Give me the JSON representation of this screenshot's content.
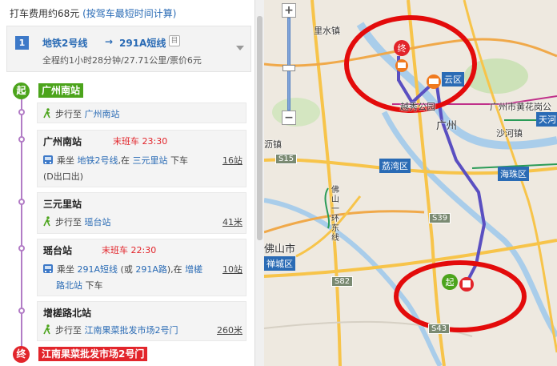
{
  "taxi": {
    "text": "打车费用约68元",
    "link": "(按驾车最短时间计算)"
  },
  "route": {
    "number": "1",
    "line_a": "地铁2号线",
    "arrow": "→",
    "line_b": "291A短线",
    "print_glyph": "目",
    "summary": "全程约1小时28分钟/27.71公里/票价6元"
  },
  "start": {
    "badge": "起",
    "label": "广州南站"
  },
  "end": {
    "badge": "终",
    "label": "江南果菜批发市场2号门"
  },
  "steps": [
    {
      "type": "walk",
      "prefix": "步行至",
      "target": "广州南站"
    },
    {
      "type": "transit",
      "title": "广州南站",
      "last_bus": "末班车 23:30",
      "ride_prefix": "乘坐",
      "line": "地铁2号线",
      "ride_mid": ",在",
      "stop": "三元里站",
      "ride_suffix": "下车",
      "note": "(D出口出)",
      "distance": "16站"
    },
    {
      "type": "walk",
      "title": "三元里站",
      "prefix": "步行至",
      "target": "瑶台站",
      "distance": "41米"
    },
    {
      "type": "transit",
      "title": "瑶台站",
      "last_bus": "末班车 22:30",
      "ride_prefix": "乘坐",
      "line": "291A短线",
      "alt_open": "(或",
      "alt_line": "291A路",
      "alt_close": "),在",
      "stop": "增槎",
      "stop2": "路北站",
      "ride_suffix": "下车",
      "distance": "10站"
    },
    {
      "type": "walk",
      "title": "增槎路北站",
      "prefix": "步行至",
      "target": "江南果菜批发市场2号门",
      "distance": "260米"
    }
  ],
  "map": {
    "zoom_in": "+",
    "zoom_out": "−",
    "labels": {
      "lihe": "里水镇",
      "baiyun": "云区",
      "gz_city": "广州",
      "huangpu": "广州市黄花岗公",
      "shahe": "沙河镇",
      "liwan": "荔湾区",
      "haizhu": "海珠区",
      "tianhe": "天河",
      "foshan": "佛山市",
      "chancheng": "禅城区",
      "fo_ring": "佛山一环东线",
      "park": "越秀公园",
      "lijiao": "沥镇"
    },
    "shields": {
      "s15": "S15",
      "s39": "S39",
      "s82": "S82",
      "s43": "S43"
    },
    "markers": {
      "start": "起",
      "end": "终"
    },
    "colors": {
      "route": "#5a4fc1",
      "highlight": "#e30b0b",
      "start": "#4ca41c",
      "end": "#e2252b",
      "bus": "#f07a1e"
    }
  }
}
